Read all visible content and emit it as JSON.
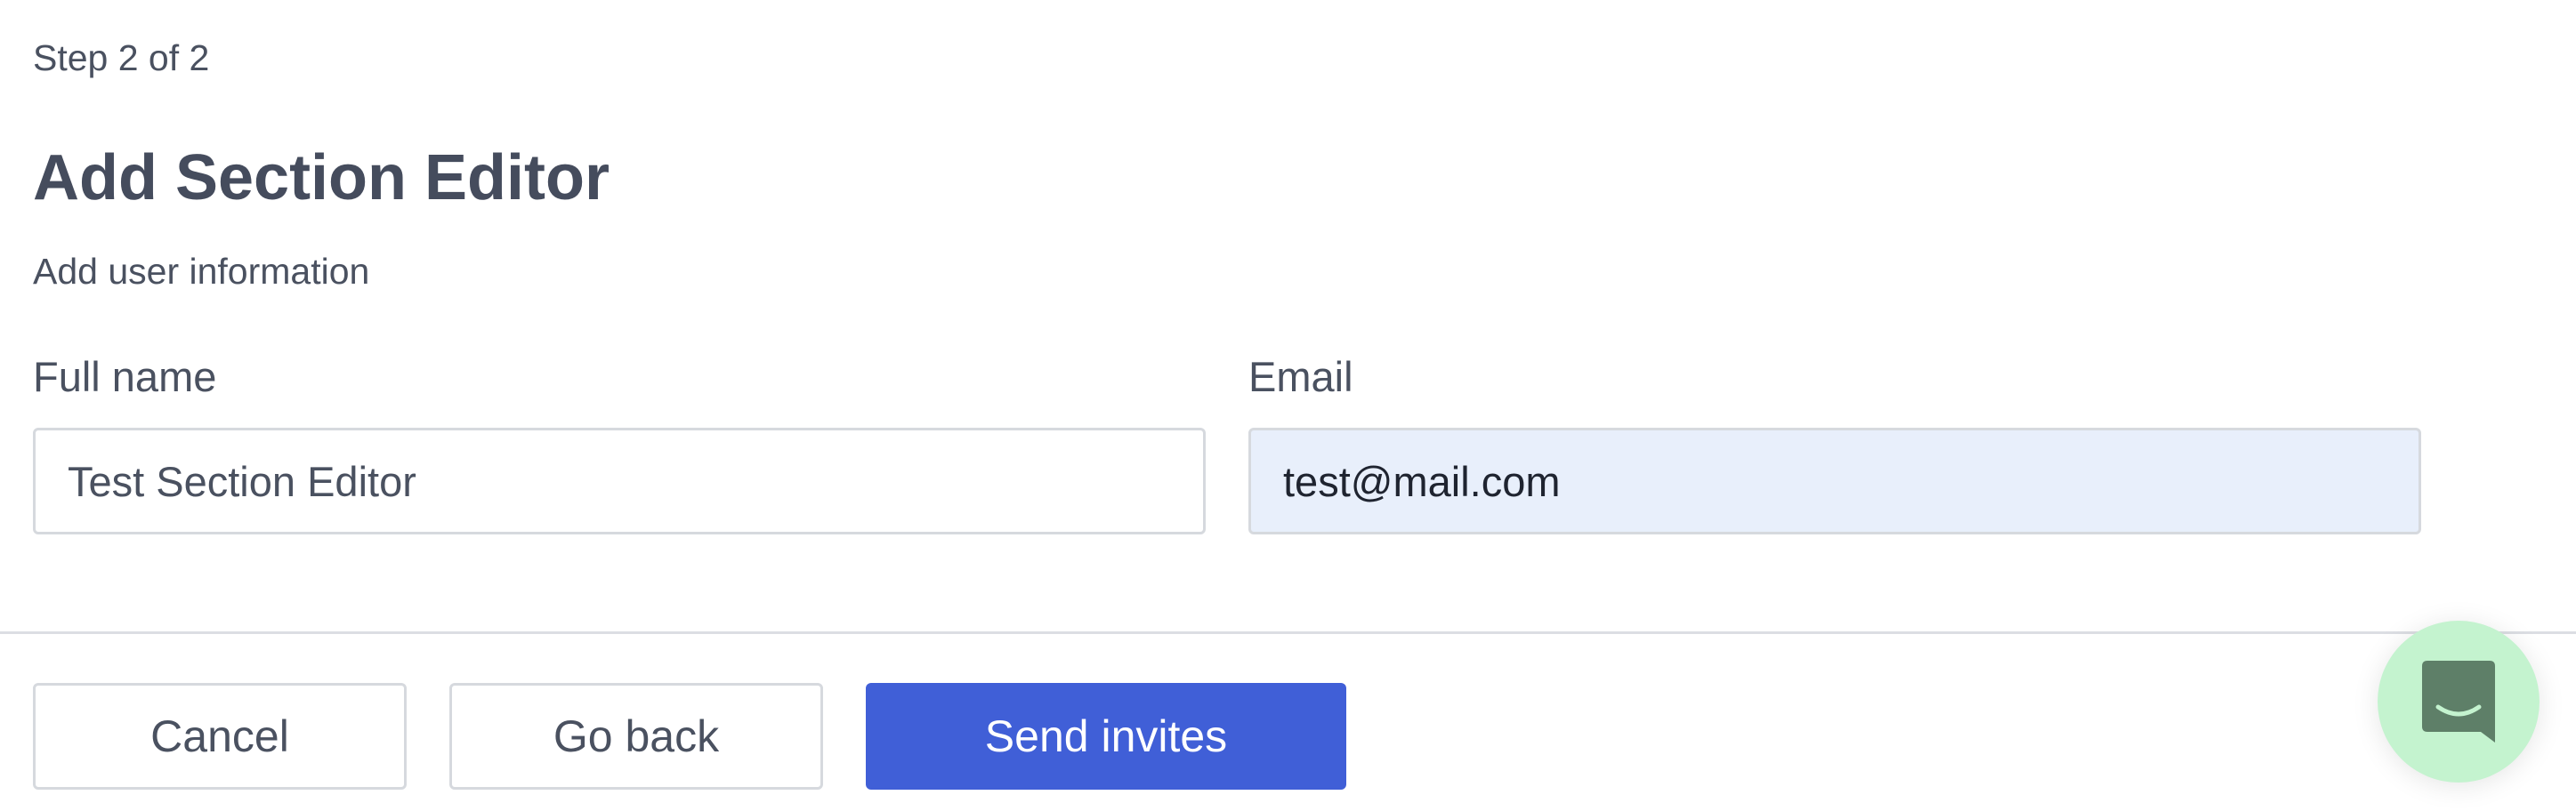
{
  "header": {
    "step": "Step 2 of 2",
    "title": "Add Section Editor",
    "subtitle": "Add user information"
  },
  "form": {
    "full_name": {
      "label": "Full name",
      "value": "Test Section Editor"
    },
    "email": {
      "label": "Email",
      "value": "test@mail.com"
    }
  },
  "footer": {
    "cancel_label": "Cancel",
    "back_label": "Go back",
    "submit_label": "Send invites"
  },
  "chat_widget": {
    "icon": "chat-bubble-icon"
  },
  "colors": {
    "primary": "#405fd7",
    "text": "#454c5d",
    "email_field_bg": "#e8effb",
    "chat_bg": "#c4f3cf",
    "chat_icon": "#5e7f68"
  }
}
